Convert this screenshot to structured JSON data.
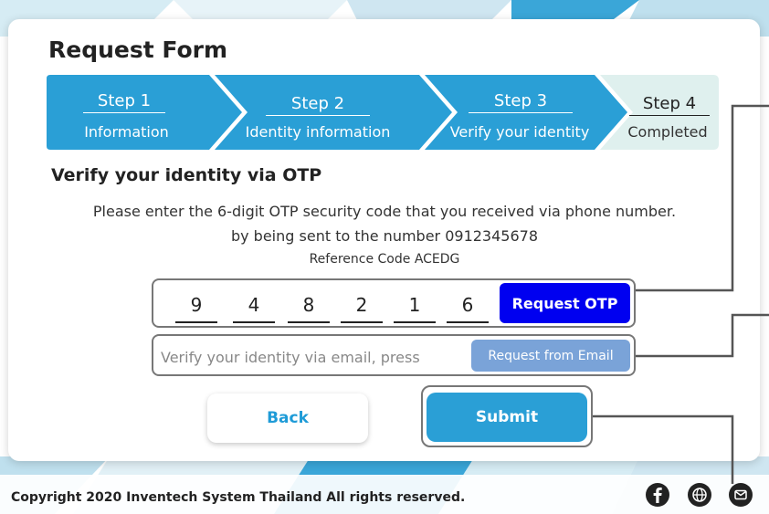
{
  "form": {
    "title": "Request Form",
    "steps": [
      {
        "title": "Step 1",
        "subtitle": "Information",
        "state": "done"
      },
      {
        "title": "Step 2",
        "subtitle": "Identity information",
        "state": "done"
      },
      {
        "title": "Step 3",
        "subtitle": "Verify your identity",
        "state": "active"
      },
      {
        "title": "Step 4",
        "subtitle": "Completed",
        "state": "pending"
      }
    ],
    "section_heading": "Verify your identity via OTP",
    "instruction_line1": "Please enter the 6-digit OTP security code that you received via phone number.",
    "instruction_line2": "by being sent to the number 0912345678",
    "reference": "Reference Code ACEDG",
    "otp_digits": [
      "9",
      "4",
      "8",
      "2",
      "1",
      "6"
    ],
    "request_otp_label": "Request OTP",
    "email_prompt": "Verify your identity via email, press",
    "request_email_label": "Request from Email",
    "back_label": "Back",
    "submit_label": "Submit"
  },
  "footer": {
    "copyright": "Copyright  2020 Inventech System Thailand All rights reserved.",
    "icons": [
      "facebook-icon",
      "globe-icon",
      "mail-icon"
    ]
  },
  "colors": {
    "step_active": "#2a9fd6",
    "step_pending": "#dff0ee",
    "otp_button": "#0000f0",
    "email_button": "#7aa3d8",
    "submit_button": "#2a9fd6",
    "back_text": "#1e9bd7"
  }
}
